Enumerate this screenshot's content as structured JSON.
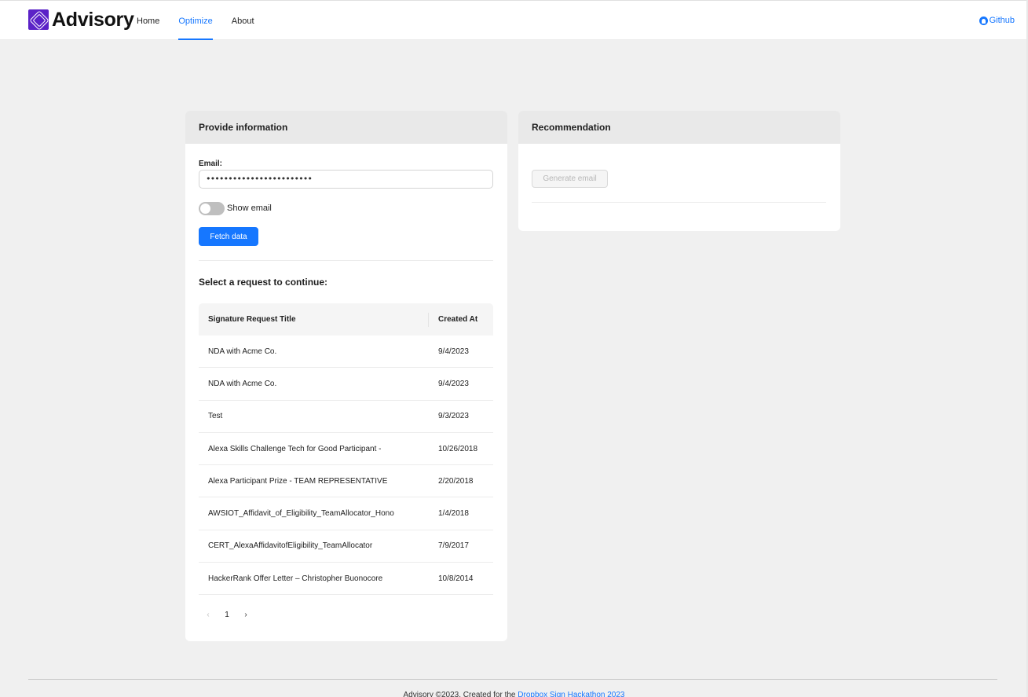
{
  "header": {
    "logo_text": "Advisory",
    "nav": [
      "Home",
      "Optimize",
      "About"
    ],
    "active_nav": "Optimize",
    "github_label": "Github"
  },
  "left_card": {
    "title": "Provide information",
    "email_label": "Email:",
    "email_value": "••••••••••••••••••••••••",
    "toggle_label": "Show email",
    "toggle_on": false,
    "fetch_button": "Fetch data",
    "section_title": "Select a request to continue:",
    "table": {
      "columns": [
        "Signature Request Title",
        "Created At"
      ],
      "rows": [
        [
          "NDA with Acme Co.",
          "9/4/2023"
        ],
        [
          "NDA with Acme Co.",
          "9/4/2023"
        ],
        [
          "Test",
          "9/3/2023"
        ],
        [
          "Alexa Skills Challenge Tech for Good Participant -",
          "10/26/2018"
        ],
        [
          "Alexa Participant Prize - TEAM REPRESENTATIVE",
          "2/20/2018"
        ],
        [
          "AWSIOT_Affidavit_of_Eligibility_TeamAllocator_Hono",
          "1/4/2018"
        ],
        [
          "CERT_AlexaAffidavitofEligibility_TeamAllocator",
          "7/9/2017"
        ],
        [
          "HackerRank Offer Letter – Christopher Buonocore",
          "10/8/2014"
        ]
      ]
    },
    "pagination": {
      "prev": "‹",
      "current": "1",
      "next": "›"
    }
  },
  "right_card": {
    "title": "Recommendation",
    "generate_button": "Generate email"
  },
  "footer": {
    "text": "Advisory ©2023. Created for the ",
    "link": "Dropbox Sign Hackathon 2023"
  },
  "colors": {
    "accent": "#1677ff",
    "logo": "#5b22c7",
    "background": "#f0f0f0"
  }
}
